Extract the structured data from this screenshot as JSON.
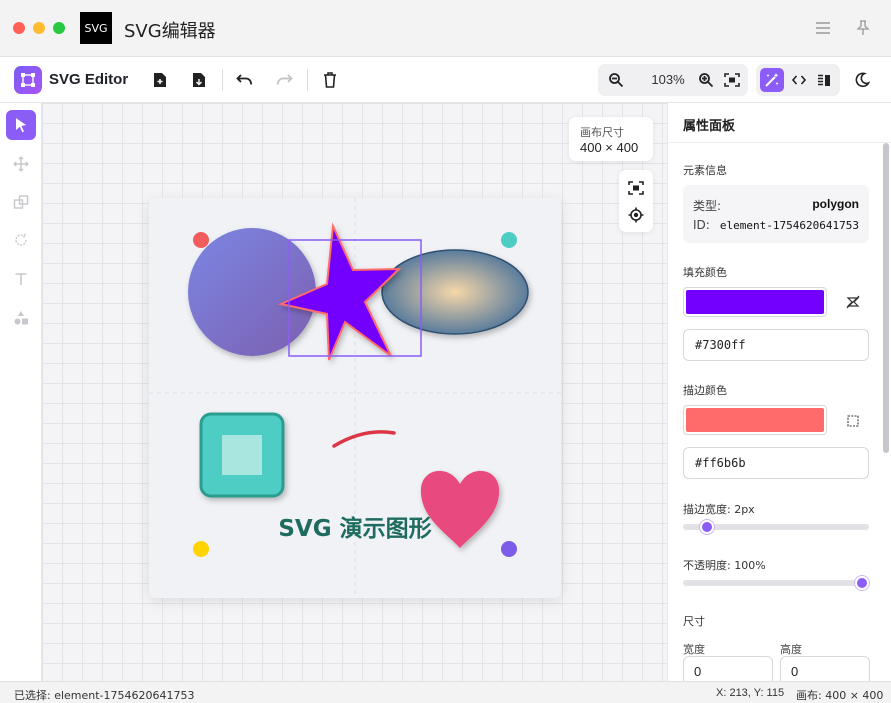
{
  "window": {
    "logo_text": "SVG",
    "title": "SVG编辑器",
    "traffic": {
      "close": "#ff5f57",
      "minimize": "#febc2e",
      "maximize": "#28c840"
    },
    "icons": [
      "menu-icon",
      "pin-icon"
    ]
  },
  "toolbar": {
    "brand_name": "SVG Editor",
    "brand_color": "#8b5cf6",
    "zoom_value": "103%",
    "buttons": [
      "new-file",
      "export-file",
      "undo",
      "redo",
      "delete",
      "zoom-out",
      "zoom-in",
      "fit-screen",
      "design-mode",
      "code-mode",
      "split-mode",
      "theme-toggle"
    ]
  },
  "left_tools": [
    "select",
    "move",
    "shape",
    "rotate",
    "text",
    "shapes-library"
  ],
  "canvas": {
    "size_label": "画布尺寸",
    "size_value": "400 × 400",
    "demo_text": "SVG 演示图形",
    "colors": {
      "circle_start": "#7b86e3",
      "circle_end": "#7b5fb0",
      "star_fill": "#7300ff",
      "star_stroke": "#ff6b6b",
      "ellipse_center": "#f6d7a9",
      "ellipse_edge": "#5a7c9c",
      "square_outer": "#4ecdc4",
      "square_inner": "#a8e6df",
      "arc": "#dc3545",
      "heart": "#e84a7f",
      "text": "#1e6c5f",
      "selection": "#8b5cf6",
      "dot_red": "#f25c5c",
      "dot_teal": "#4ecdc4",
      "dot_yellow": "#ffd400",
      "dot_purple": "#7c5ce8"
    }
  },
  "panel": {
    "title": "属性面板",
    "element_info_label": "元素信息",
    "type_label": "类型:",
    "type_value": "polygon",
    "id_label": "ID:",
    "id_value": "element-1754620641753",
    "fill_label": "填充颜色",
    "fill_color": "#7300ff",
    "fill_hex": "#7300ff",
    "stroke_label": "描边颜色",
    "stroke_color": "#ff6b6b",
    "stroke_hex": "#ff6b6b",
    "stroke_width_label": "描边宽度: 2px",
    "stroke_width_fraction": 0.13,
    "opacity_label": "不透明度: 100%",
    "opacity_fraction": 1.0,
    "size_label": "尺寸",
    "width_label": "宽度",
    "height_label": "高度",
    "width_value": "0",
    "height_value": "0"
  },
  "status": {
    "selected": "已选择: element-1754620641753",
    "coords": "X: 213, Y: 115",
    "canvas": "画布: 400 × 400"
  }
}
